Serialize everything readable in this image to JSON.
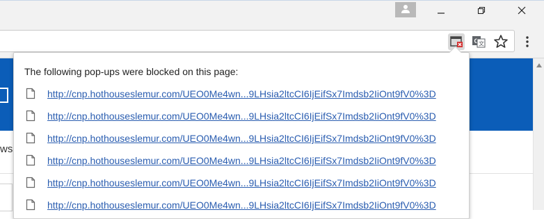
{
  "window": {
    "avatar_icon": "person-icon",
    "controls": [
      "minimize-icon",
      "restore-icon",
      "close-icon"
    ]
  },
  "toolbar": {
    "icons": [
      "popup-blocked-icon",
      "translate-icon",
      "bookmark-star-icon",
      "menu-kebab-icon"
    ],
    "accent_blocked": "#d32f2f"
  },
  "page": {
    "accent": "#0b5db8",
    "text_fragment": "ws"
  },
  "popup_bubble": {
    "message": "The following pop-ups were blocked on this page:",
    "links": [
      "http://cnp.hothouseslemur.com/UEO0Me4wn...9LHsia2ltcCI6IjEifSx7Imdsb2IiOnt9fV0%3D",
      "http://cnp.hothouseslemur.com/UEO0Me4wn...9LHsia2ltcCI6IjEifSx7Imdsb2IiOnt9fV0%3D",
      "http://cnp.hothouseslemur.com/UEO0Me4wn...9LHsia2ltcCI6IjEifSx7Imdsb2IiOnt9fV0%3D",
      "http://cnp.hothouseslemur.com/UEO0Me4wn...9LHsia2ltcCI6IjEifSx7Imdsb2IiOnt9fV0%3D",
      "http://cnp.hothouseslemur.com/UEO0Me4wn...9LHsia2ltcCI6IjEifSx7Imdsb2IiOnt9fV0%3D",
      "http://cnp.hothouseslemur.com/UEO0Me4wn...9LHsia2ltcCI6IjEifSx7Imdsb2IiOnt9fV0%3D"
    ],
    "link_color": "#2a5db0"
  }
}
